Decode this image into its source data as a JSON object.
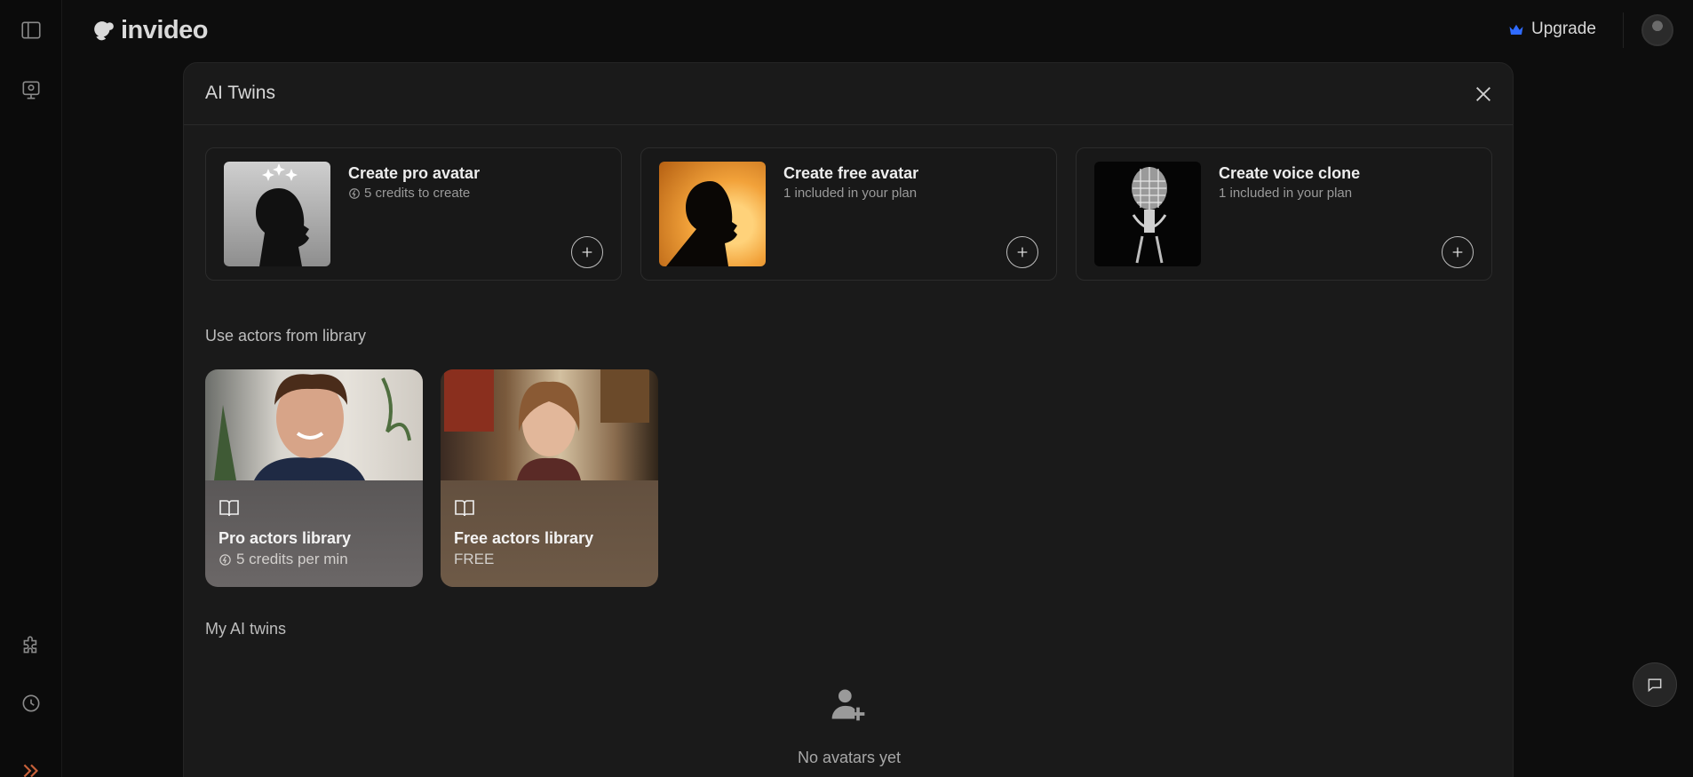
{
  "app": {
    "brand": "invideo",
    "upgrade_label": "Upgrade"
  },
  "modal": {
    "title": "AI Twins",
    "create_cards": [
      {
        "title": "Create pro avatar",
        "subtitle": "5 credits to create"
      },
      {
        "title": "Create free avatar",
        "subtitle": "1 included in your plan"
      },
      {
        "title": "Create voice clone",
        "subtitle": "1 included in your plan"
      }
    ],
    "library_section": "Use actors from library",
    "libraries": [
      {
        "title": "Pro actors library",
        "subtitle": "5 credits per min"
      },
      {
        "title": "Free actors library",
        "subtitle": "FREE"
      }
    ],
    "my_twins_section": "My AI twins",
    "empty_text": "No avatars yet"
  },
  "colors": {
    "background": "#0d0d0d",
    "modal": "#1a1a1a",
    "upgrade_icon": "#2f6bff"
  }
}
